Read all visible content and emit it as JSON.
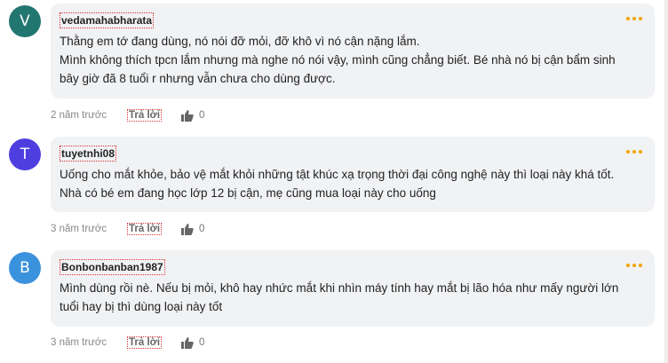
{
  "colors": {
    "accent": "#f0a500",
    "bubble": "#f1f2f4"
  },
  "actions": {
    "reply_label": "Trả lời",
    "more_icon": "three-dots-icon",
    "like_icon": "thumbs-up-icon"
  },
  "comments": [
    {
      "avatar_letter": "V",
      "avatar_color": "#21766f",
      "author": "vedamahabharata",
      "lines": [
        "Thằng em tớ đang dùng, nó nói đỡ mỏi, đỡ khô vì nó cận nặng lắm.",
        "Mình không thích tpcn lắm nhưng mà nghe nó nói vậy, mình cũng chẳng biết. Bé nhà nó bị cận bẩm sinh",
        "bây giờ đã 8 tuổi r nhưng vẫn chưa cho dùng được."
      ],
      "time": "2 năm trước",
      "likes": "0"
    },
    {
      "avatar_letter": "T",
      "avatar_color": "#4e3ee0",
      "author": "tuyetnhi08",
      "lines": [
        "Uống cho mắt khỏe, bảo vệ mắt khỏi những tật khúc xạ trọng thời đại công nghệ này thì loại này khá tốt.",
        "Nhà có bé em đang học lớp 12 bị cận, mẹ cũng mua loại này cho uống"
      ],
      "time": "3 năm trước",
      "likes": "0"
    },
    {
      "avatar_letter": "B",
      "avatar_color": "#3a92dc",
      "author": "Bonbonbanban1987",
      "lines": [
        "Mình dùng rồi nè. Nếu bị mỏi, khô hay nhức mắt khi nhìn máy tính hay mắt bị lão hóa như mấy người lớn",
        "tuổi hay bị thì dùng loại này tốt"
      ],
      "time": "3 năm trước",
      "likes": "0"
    }
  ]
}
